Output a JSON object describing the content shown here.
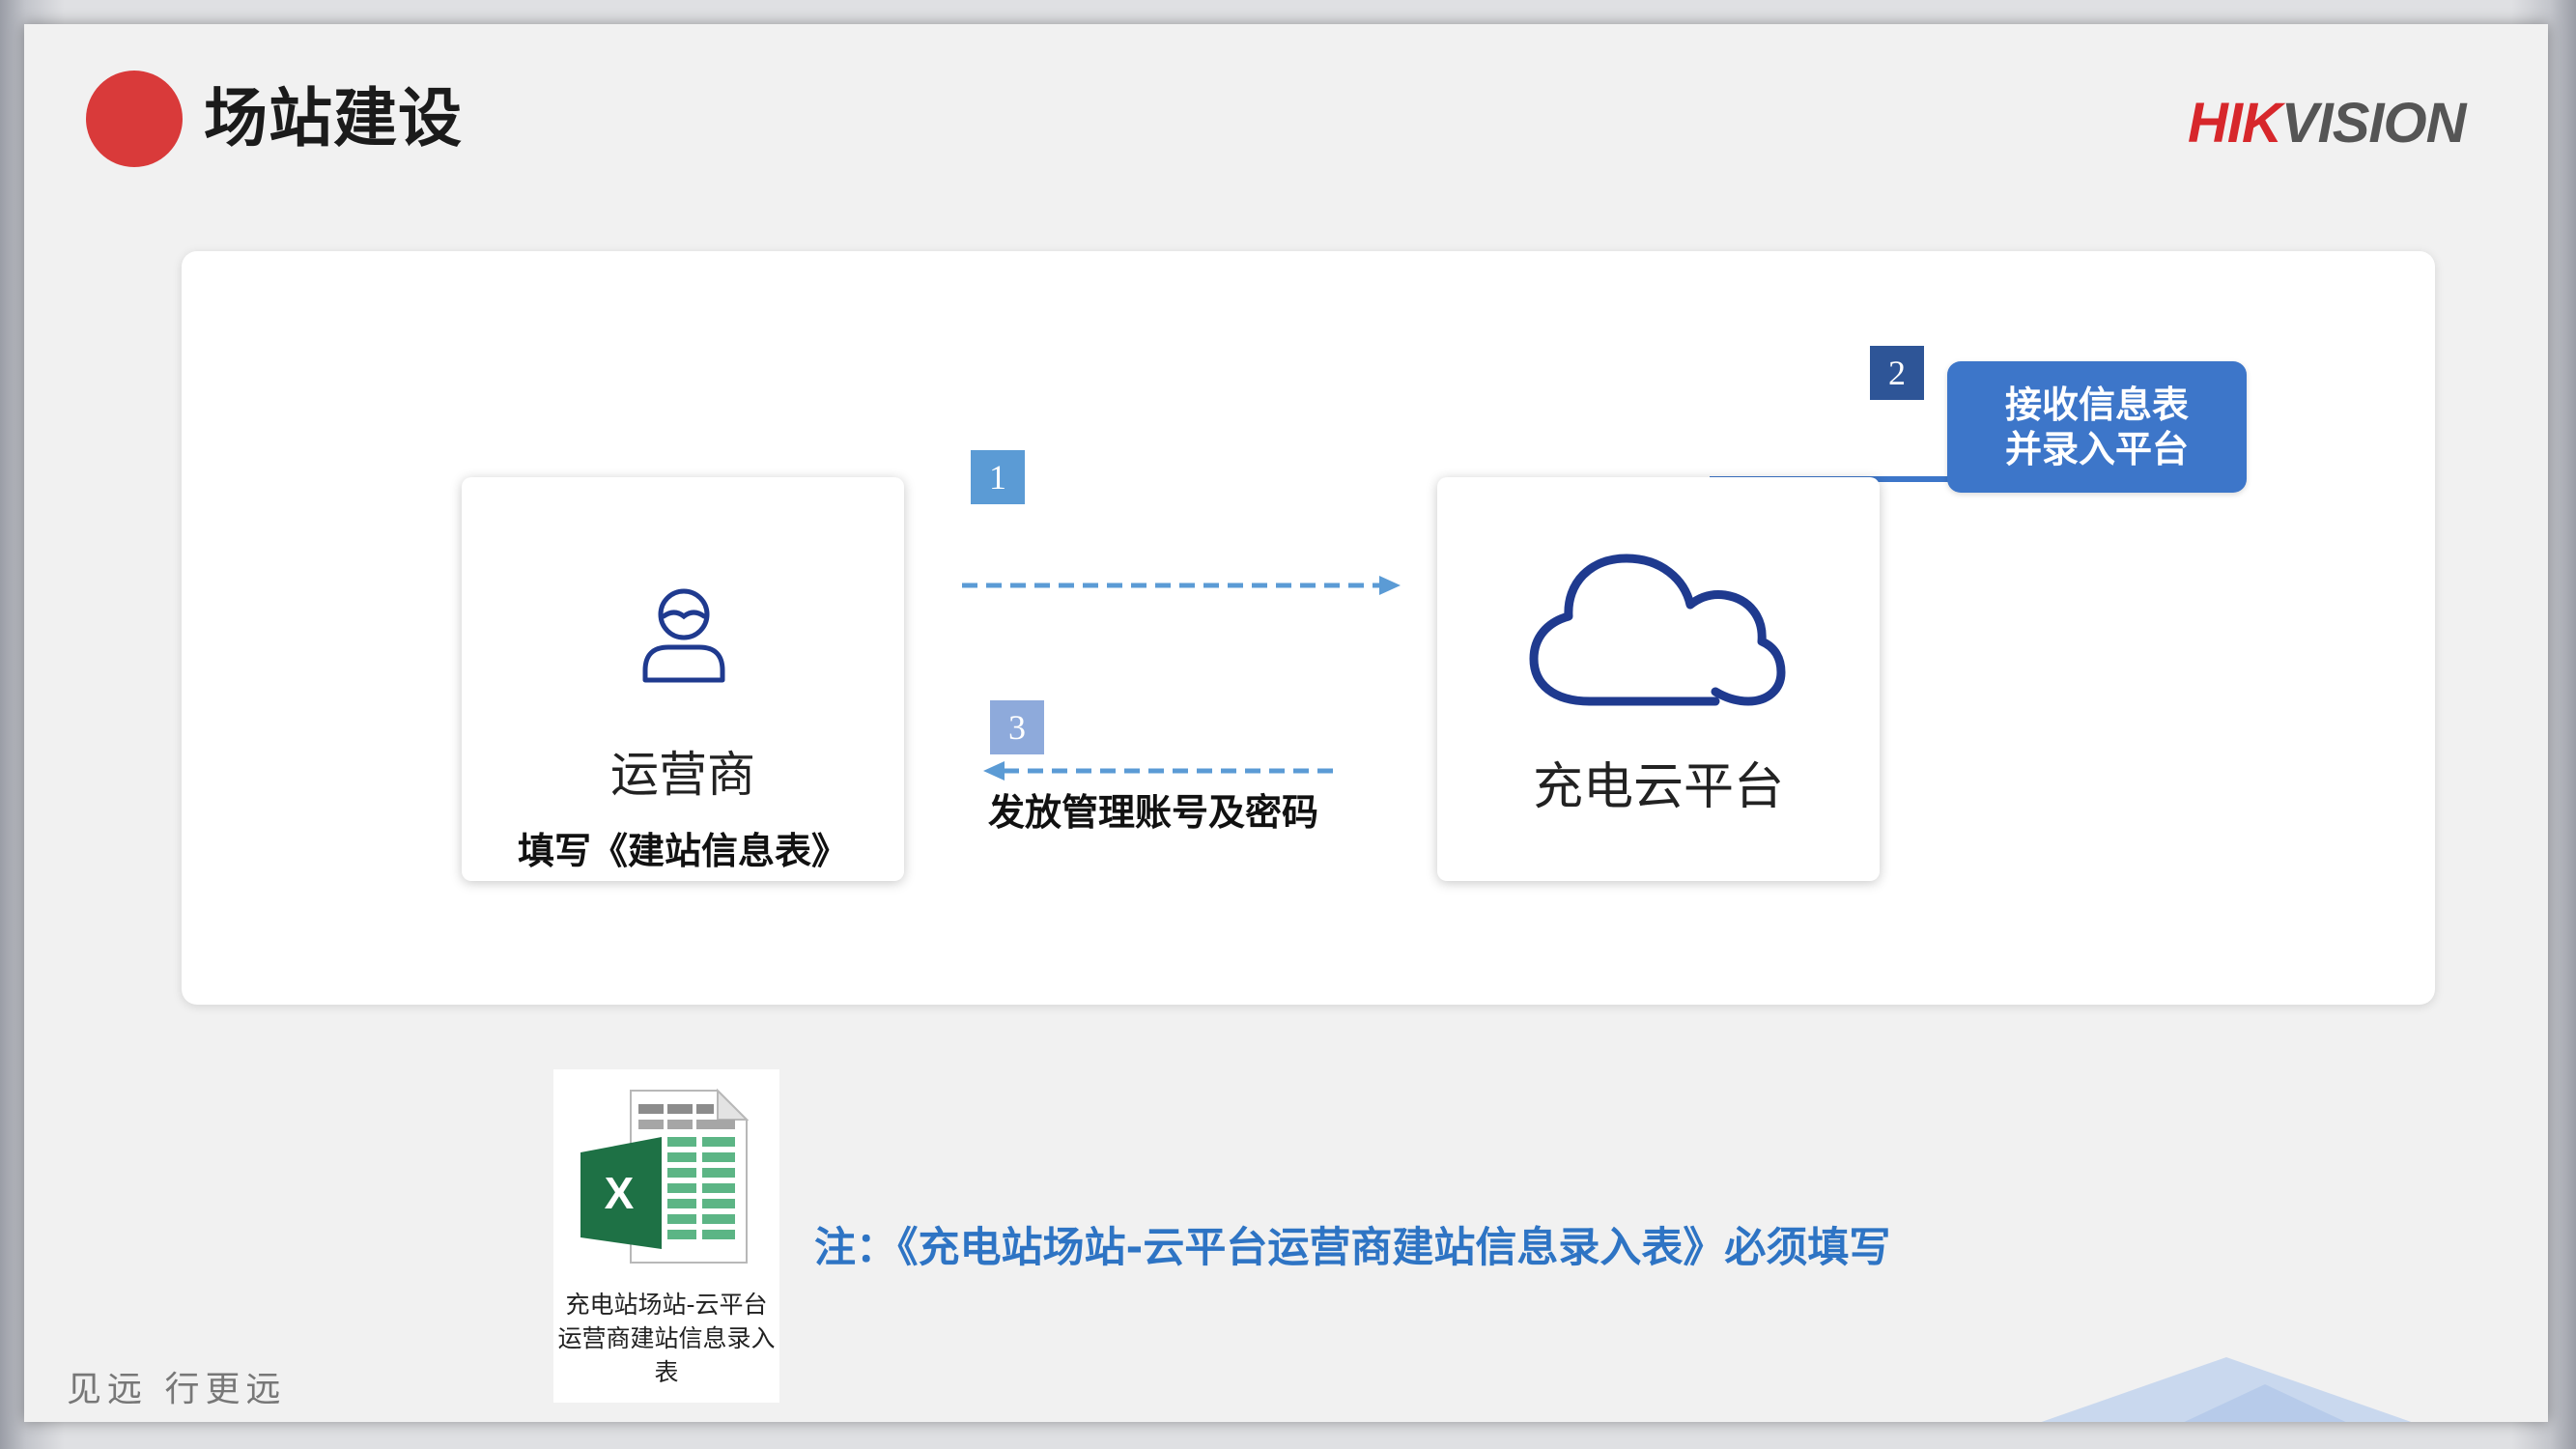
{
  "header": {
    "title": "场站建设",
    "logo_text": "HIKVISION"
  },
  "operator": {
    "name": "运营商",
    "subtitle": "填写《建站信息表》"
  },
  "cloud": {
    "name": "充电云平台"
  },
  "steps": {
    "step1": "1",
    "step2": "2",
    "step3": "3"
  },
  "flow": {
    "return_label": "发放管理账号及密码",
    "receive_line1": "接收信息表",
    "receive_line2": "并录入平台"
  },
  "file": {
    "icon_letter": "X",
    "name": "充电站场站-云平台运营商建站信息录入表"
  },
  "note": "注：《充电站场站-云平台运营商建站信息录入表》必须填写",
  "footer": {
    "slogan": "见远 行更远"
  },
  "colors": {
    "title_dot": "#d93a3a",
    "logo_red": "#d7272b",
    "logo_gray": "#555555",
    "accent_blue": "#3d76c9",
    "icon_navy": "#1f3a8f",
    "note_blue": "#2e74c4",
    "excel_green": "#1e7145"
  },
  "icons": {
    "operator": "person-icon",
    "cloud": "cloud-icon",
    "file": "excel-file-icon"
  }
}
